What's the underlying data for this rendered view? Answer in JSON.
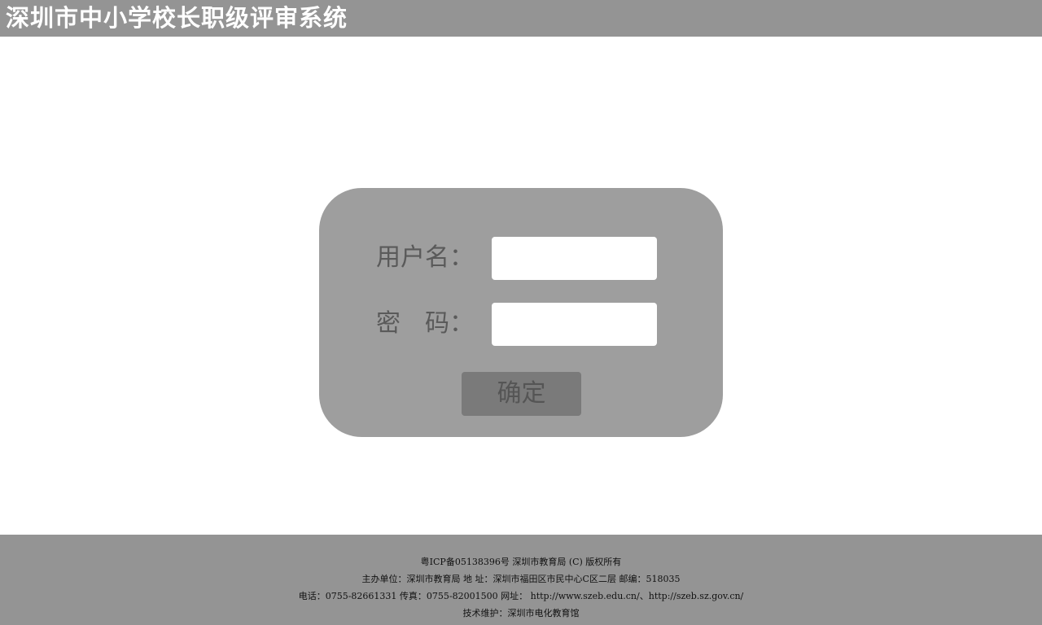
{
  "header": {
    "title": "深圳市中小学校长职级评审系统"
  },
  "login": {
    "username_label": "用户名：",
    "password_label_part1": "密",
    "password_label_part2": "码：",
    "username_value": "",
    "password_value": "",
    "confirm_label": "确定"
  },
  "footer": {
    "line1": "粤ICP备05138396号 深圳市教育局 (C) 版权所有",
    "line2": "主办单位：深圳市教育局 地 址：深圳市福田区市民中心C区二层 邮编：518035",
    "line3_prefix": "电话：0755-82661331 传真：0755-82001500 网址：",
    "link1": "http://www.szeb.edu.cn/",
    "separator": "、",
    "link2": "http://szeb.sz.gov.cn/",
    "line4": "技术维护：深圳市电化教育馆"
  },
  "colors": {
    "header_bg": "#949494",
    "panel_bg": "#9e9e9e",
    "button_bg": "#7a7a7a",
    "footer_bg": "#949494"
  }
}
